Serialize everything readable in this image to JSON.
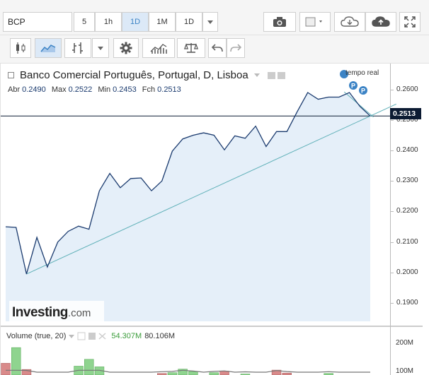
{
  "toolbar": {
    "symbol": "BCP",
    "intervals": [
      {
        "label": "5",
        "active": false
      },
      {
        "label": "1h",
        "active": false
      },
      {
        "label": "1D",
        "active": true
      },
      {
        "label": "1M",
        "active": false
      },
      {
        "label": "1D",
        "active": false
      }
    ]
  },
  "legend": {
    "title": "Banco Comercial Português, Portugal, D, Lisboa",
    "open_label": "Abr",
    "open_value": "0.2490",
    "high_label": "Max",
    "high_value": "0.2522",
    "low_label": "Min",
    "low_value": "0.2453",
    "close_label": "Fch",
    "close_value": "0.2513",
    "realtime": "tempo real"
  },
  "brand": {
    "name": "Investing",
    "suffix": ".com"
  },
  "price_tag": "0.2513",
  "volume": {
    "label": "Volume (true, 20)",
    "value1": "54.307M",
    "value2": "80.106M",
    "ticks": [
      "200M",
      "100M"
    ]
  },
  "colors": {
    "line": "#1a3a6e",
    "area": "#dce9f7",
    "trend": "#5fb0b8",
    "vol_up": "#8fd48f",
    "vol_down": "#d98a8a",
    "accent": "#3b83c5"
  },
  "chart_data": {
    "type": "area",
    "ylim": [
      0.184,
      0.2685
    ],
    "yticks": [
      "0.2600",
      "0.2500",
      "0.2400",
      "0.2300",
      "0.2200",
      "0.2100",
      "0.2000",
      "0.1900"
    ],
    "values": [
      0.215,
      0.2148,
      0.1995,
      0.2115,
      0.2018,
      0.21,
      0.2135,
      0.2152,
      0.2142,
      0.2268,
      0.2325,
      0.2278,
      0.2308,
      0.231,
      0.2268,
      0.23,
      0.2398,
      0.2438,
      0.245,
      0.2458,
      0.245,
      0.2402,
      0.2448,
      0.244,
      0.248,
      0.2413,
      0.2462,
      0.2462,
      0.2528,
      0.259,
      0.2568,
      0.2575,
      0.2575,
      0.259,
      0.2545,
      0.2513
    ],
    "trendline": [
      [
        2,
        0.1995
      ],
      [
        35,
        0.2513
      ]
    ],
    "volume": {
      "values": [
        60,
        140,
        28,
        0,
        0,
        0,
        0,
        45,
        80,
        42,
        0,
        0,
        0,
        0,
        0,
        8,
        12,
        30,
        18,
        0,
        12,
        20,
        0,
        5,
        0,
        0,
        25,
        10,
        0,
        0,
        0,
        8,
        0,
        0,
        0,
        0
      ],
      "up": [
        false,
        true,
        false,
        false,
        false,
        false,
        false,
        true,
        true,
        true,
        false,
        false,
        false,
        false,
        false,
        false,
        true,
        true,
        true,
        false,
        true,
        false,
        false,
        true,
        false,
        false,
        false,
        false,
        false,
        false,
        false,
        true,
        false,
        false,
        false,
        false
      ],
      "max": 220
    }
  }
}
